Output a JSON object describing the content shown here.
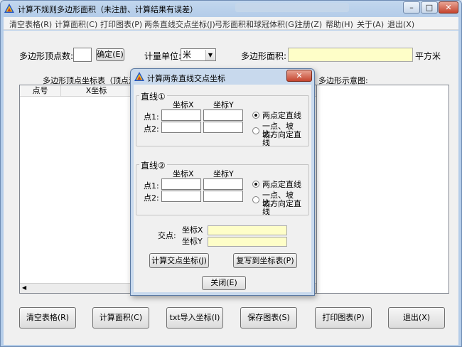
{
  "window": {
    "title": "计算不规则多边形面积（未注册、计算结果有误差）",
    "controls": {
      "minimize": "–",
      "maximize": "□",
      "close": "✕"
    }
  },
  "menu": [
    "清空表格(R)",
    "计算面积(C)",
    "打印图表(P)",
    "两条直线交点坐标(J)",
    "弓形面积和球冠体积(G)",
    "注册(Z)",
    "帮助(H)",
    "关于(A)",
    "退出(X)"
  ],
  "top_bar": {
    "vertex_count_label": "多边形顶点数:",
    "vertex_count_value": "",
    "confirm_button": "确定(E)",
    "unit_label": "计量单位:",
    "unit_value": "米",
    "area_label": "多边形面积:",
    "area_value": "",
    "area_unit": "平方米"
  },
  "table": {
    "caption": "多边形顶点坐标表（顶点沿着",
    "columns": [
      "点号",
      "X坐标"
    ]
  },
  "diagram": {
    "caption": "多边形示意图:"
  },
  "bottom_buttons": [
    "清空表格(R)",
    "计算面积(C)",
    "txt导入坐标(I)",
    "保存图表(S)",
    "打印图表(P)",
    "退出(X)"
  ],
  "dialog": {
    "title": "计算两条直线交点坐标",
    "line1": {
      "title": "直线①",
      "col_x": "坐标X",
      "col_y": "坐标Y",
      "p1_label": "点1:",
      "p2_label": "点2:",
      "p1_x": "",
      "p1_y": "",
      "p2_x": "",
      "p2_y": "",
      "option1": "两点定直线",
      "option2_line1": "一点、坡比、",
      "option2_line2": "坡方向定直线",
      "selected": "option1"
    },
    "line2": {
      "title": "直线②",
      "col_x": "坐标X",
      "col_y": "坐标Y",
      "p1_label": "点1:",
      "p2_label": "点2:",
      "p1_x": "",
      "p1_y": "",
      "p2_x": "",
      "p2_y": "",
      "option1": "两点定直线",
      "option2_line1": "一点、坡比、",
      "option2_line2": "坡方向定直线",
      "selected": "option1"
    },
    "intersection": {
      "label": "交点:",
      "x_label": "坐标X",
      "y_label": "坐标Y",
      "x_value": "",
      "y_value": ""
    },
    "calc_button": "计算交点坐标(J)",
    "copy_button": "复写到坐标表(P)",
    "close_button": "关闭(E)",
    "close_x": "✕"
  }
}
